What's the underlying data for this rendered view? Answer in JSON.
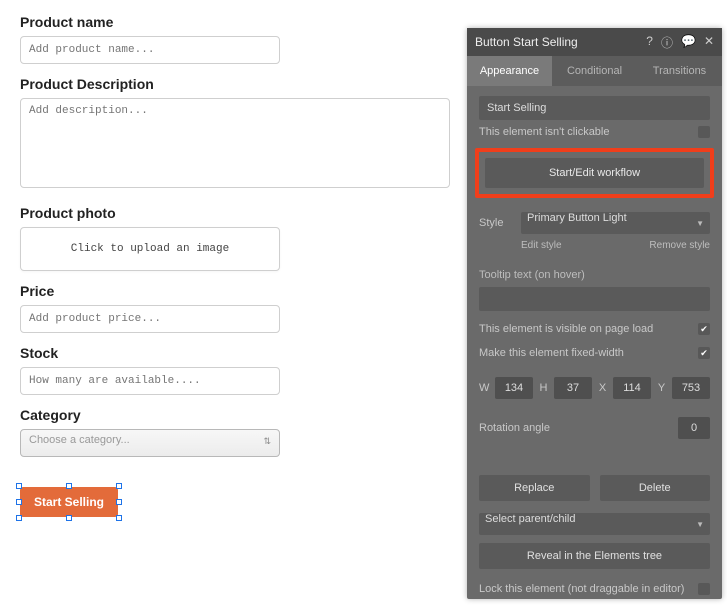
{
  "form": {
    "product_name": {
      "label": "Product name",
      "placeholder": "Add product name..."
    },
    "description": {
      "label": "Product Description",
      "placeholder": "Add description..."
    },
    "photo": {
      "label": "Product photo",
      "upload_text": "Click to upload an image"
    },
    "price": {
      "label": "Price",
      "placeholder": "Add product price..."
    },
    "stock": {
      "label": "Stock",
      "placeholder": "How many are available...."
    },
    "category": {
      "label": "Category",
      "placeholder": "Choose a category..."
    },
    "start_button": "Start Selling"
  },
  "panel": {
    "title": "Button Start Selling",
    "tabs": {
      "appearance": "Appearance",
      "conditional": "Conditional",
      "transitions": "Transitions"
    },
    "element_text_value": "Start Selling",
    "not_clickable": "This element isn't clickable",
    "workflow_btn": "Start/Edit workflow",
    "style_label": "Style",
    "style_value": "Primary Button Light",
    "edit_style": "Edit style",
    "remove_style": "Remove style",
    "tooltip_label": "Tooltip text (on hover)",
    "visible_on_load": "This element is visible on page load",
    "fixed_width": "Make this element fixed-width",
    "dims": {
      "wlab": "W",
      "w": "134",
      "hlab": "H",
      "h": "37",
      "xlab": "X",
      "x": "114",
      "ylab": "Y",
      "y": "753"
    },
    "rotation_label": "Rotation angle",
    "rotation_value": "0",
    "replace": "Replace",
    "delete": "Delete",
    "select_parent": "Select parent/child",
    "reveal": "Reveal in the Elements tree",
    "lock": "Lock this element (not draggable in editor)"
  }
}
